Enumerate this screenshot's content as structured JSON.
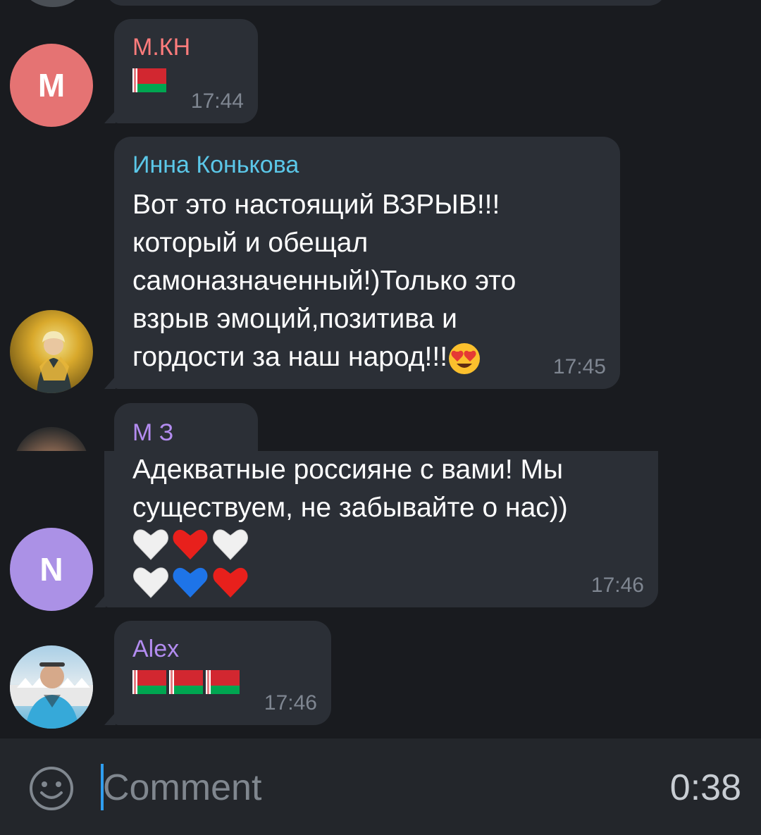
{
  "messages": [
    {
      "sender": "М.КН",
      "sender_color": "#ff7c7c",
      "text": "",
      "flags": 1,
      "time": "17:44",
      "avatar_letter": "M",
      "avatar_color": "#e57373"
    },
    {
      "sender": "Инна Конькова",
      "sender_color": "#5bc7e8",
      "text": "Вот это настоящий ВЗРЫВ!!! который и обещал самоназначенный!)Только это взрыв эмоций,позитива и гордости за наш народ!!!",
      "emoji": "heart-eyes",
      "time": "17:45"
    },
    {
      "sender": "М З",
      "sender_color": "#b38cf0",
      "text": "Адекватные россияне с вами! Мы существуем, не забывайте о нас))",
      "time": "17:46",
      "avatar_letter": "N",
      "avatar_color": "#ab91e6"
    },
    {
      "sender": "Alex",
      "sender_color": "#b38cf0",
      "text": "",
      "flags": 3,
      "time": "17:46"
    }
  ],
  "composer": {
    "placeholder": "Comment",
    "timer": "0:38"
  }
}
